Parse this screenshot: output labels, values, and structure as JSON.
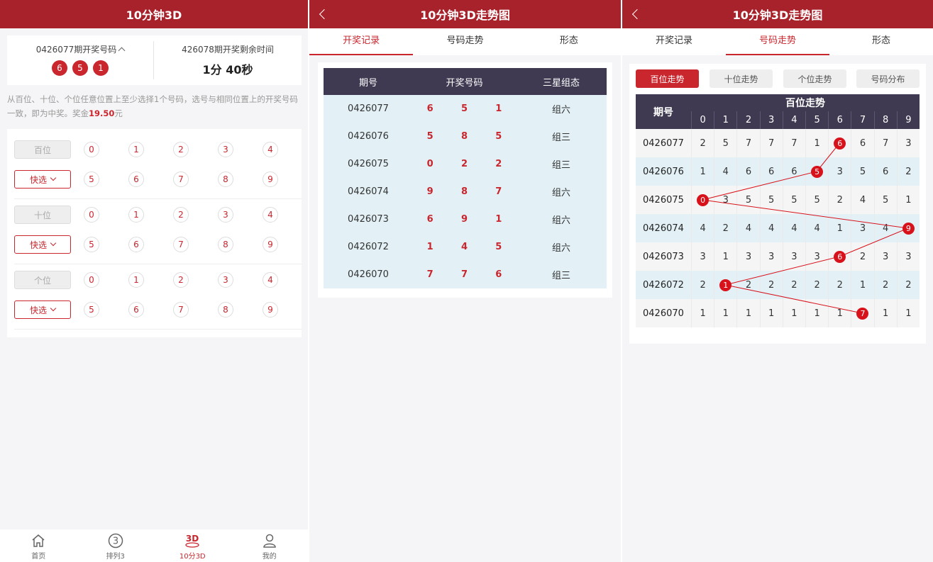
{
  "screen1": {
    "title": "10分钟3D",
    "last_issue_label": "0426077期开奖号码",
    "last_numbers": [
      "6",
      "5",
      "1"
    ],
    "next_issue_label": "426078期开奖剩余时间",
    "countdown": "1分 40秒",
    "rule_text": "从百位、十位、个位任意位置上至少选择1个号码，选号与相同位置上的开奖号码一致，即为中奖。奖金",
    "prize": "19.50",
    "prize_unit": "元",
    "positions": [
      {
        "label": "百位",
        "quick": "快选"
      },
      {
        "label": "十位",
        "quick": "快选"
      },
      {
        "label": "个位",
        "quick": "快选"
      }
    ],
    "digits": [
      "0",
      "1",
      "2",
      "3",
      "4",
      "5",
      "6",
      "7",
      "8",
      "9"
    ],
    "tabbar": [
      {
        "label": "首页",
        "icon": "home-icon"
      },
      {
        "label": "排列3",
        "icon": "pailie3-icon"
      },
      {
        "label": "10分3D",
        "icon": "3d-icon",
        "active": true
      },
      {
        "label": "我的",
        "icon": "user-icon"
      }
    ]
  },
  "screen2": {
    "title": "10分钟3D走势图",
    "tabs": [
      "开奖记录",
      "号码走势",
      "形态"
    ],
    "active_tab": 0,
    "table": {
      "headers": [
        "期号",
        "开奖号码",
        "三星组态"
      ],
      "rows": [
        {
          "issue": "0426077",
          "nums": [
            "6",
            "5",
            "1"
          ],
          "type": "组六"
        },
        {
          "issue": "0426076",
          "nums": [
            "5",
            "8",
            "5"
          ],
          "type": "组三"
        },
        {
          "issue": "0426075",
          "nums": [
            "0",
            "2",
            "2"
          ],
          "type": "组三"
        },
        {
          "issue": "0426074",
          "nums": [
            "9",
            "8",
            "7"
          ],
          "type": "组六"
        },
        {
          "issue": "0426073",
          "nums": [
            "6",
            "9",
            "1"
          ],
          "type": "组六"
        },
        {
          "issue": "0426072",
          "nums": [
            "1",
            "4",
            "5"
          ],
          "type": "组六"
        },
        {
          "issue": "0426070",
          "nums": [
            "7",
            "7",
            "6"
          ],
          "type": "组三"
        }
      ]
    }
  },
  "screen3": {
    "title": "10分钟3D走势图",
    "tabs": [
      "开奖记录",
      "号码走势",
      "形态"
    ],
    "active_tab": 1,
    "subtabs": [
      "百位走势",
      "十位走势",
      "个位走势",
      "号码分布"
    ],
    "active_subtab": 0,
    "grid": {
      "issue_header": "期号",
      "group_header": "百位走势",
      "digits": [
        "0",
        "1",
        "2",
        "3",
        "4",
        "5",
        "6",
        "7",
        "8",
        "9"
      ],
      "rows": [
        {
          "issue": "0426077",
          "cells": [
            "2",
            "5",
            "7",
            "7",
            "7",
            "1",
            "6",
            "6",
            "7",
            "3"
          ],
          "hit": 6
        },
        {
          "issue": "0426076",
          "cells": [
            "1",
            "4",
            "6",
            "6",
            "6",
            "5",
            "3",
            "5",
            "6",
            "2"
          ],
          "hit": 5
        },
        {
          "issue": "0426075",
          "cells": [
            "0",
            "3",
            "5",
            "5",
            "5",
            "5",
            "2",
            "4",
            "5",
            "1"
          ],
          "hit": 0
        },
        {
          "issue": "0426074",
          "cells": [
            "4",
            "2",
            "4",
            "4",
            "4",
            "4",
            "1",
            "3",
            "4",
            "9"
          ],
          "hit": 9
        },
        {
          "issue": "0426073",
          "cells": [
            "3",
            "1",
            "3",
            "3",
            "3",
            "3",
            "6",
            "2",
            "3",
            "3"
          ],
          "hit": 6
        },
        {
          "issue": "0426072",
          "cells": [
            "2",
            "1",
            "2",
            "2",
            "2",
            "2",
            "2",
            "1",
            "2",
            "2"
          ],
          "hit": 1
        },
        {
          "issue": "0426070",
          "cells": [
            "1",
            "1",
            "1",
            "1",
            "1",
            "1",
            "1",
            "7",
            "1",
            "1"
          ],
          "hit": 7
        }
      ]
    },
    "colors": {
      "accent": "#c9262d",
      "header": "#3f3a51",
      "hit_ball": "#d8121a",
      "trend_line": "#d8121a"
    }
  }
}
